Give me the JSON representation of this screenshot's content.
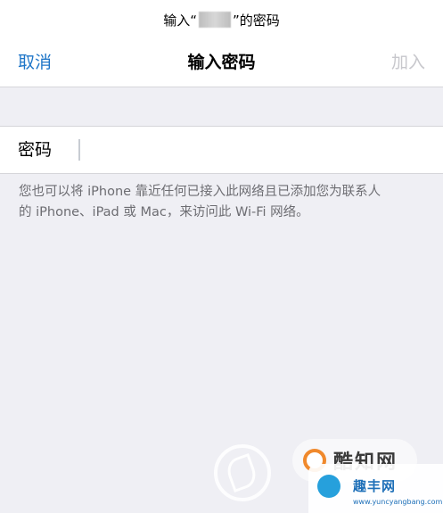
{
  "prompt": {
    "prefix": "输入“",
    "suffix": "”的密码"
  },
  "navbar": {
    "cancel_label": "取消",
    "title": "输入密码",
    "join_label": "加入"
  },
  "password_field": {
    "label": "密码",
    "value": "",
    "placeholder": ""
  },
  "hint": {
    "line1": "您也可以将 iPhone 靠近任何已接入此网络且已添加您为联系人",
    "line2": "的 iPhone、iPad 或 Mac，来访问此 Wi-Fi 网络。"
  },
  "watermark": {
    "stamp_text": "酷知网",
    "badge_title": "趣丰网",
    "badge_url": "www.yuncyangbang.com"
  },
  "colors": {
    "accent": "#1f76c8",
    "disabled": "#c7c7cc",
    "background": "#efeff4",
    "hint_text": "#6d6d72"
  }
}
